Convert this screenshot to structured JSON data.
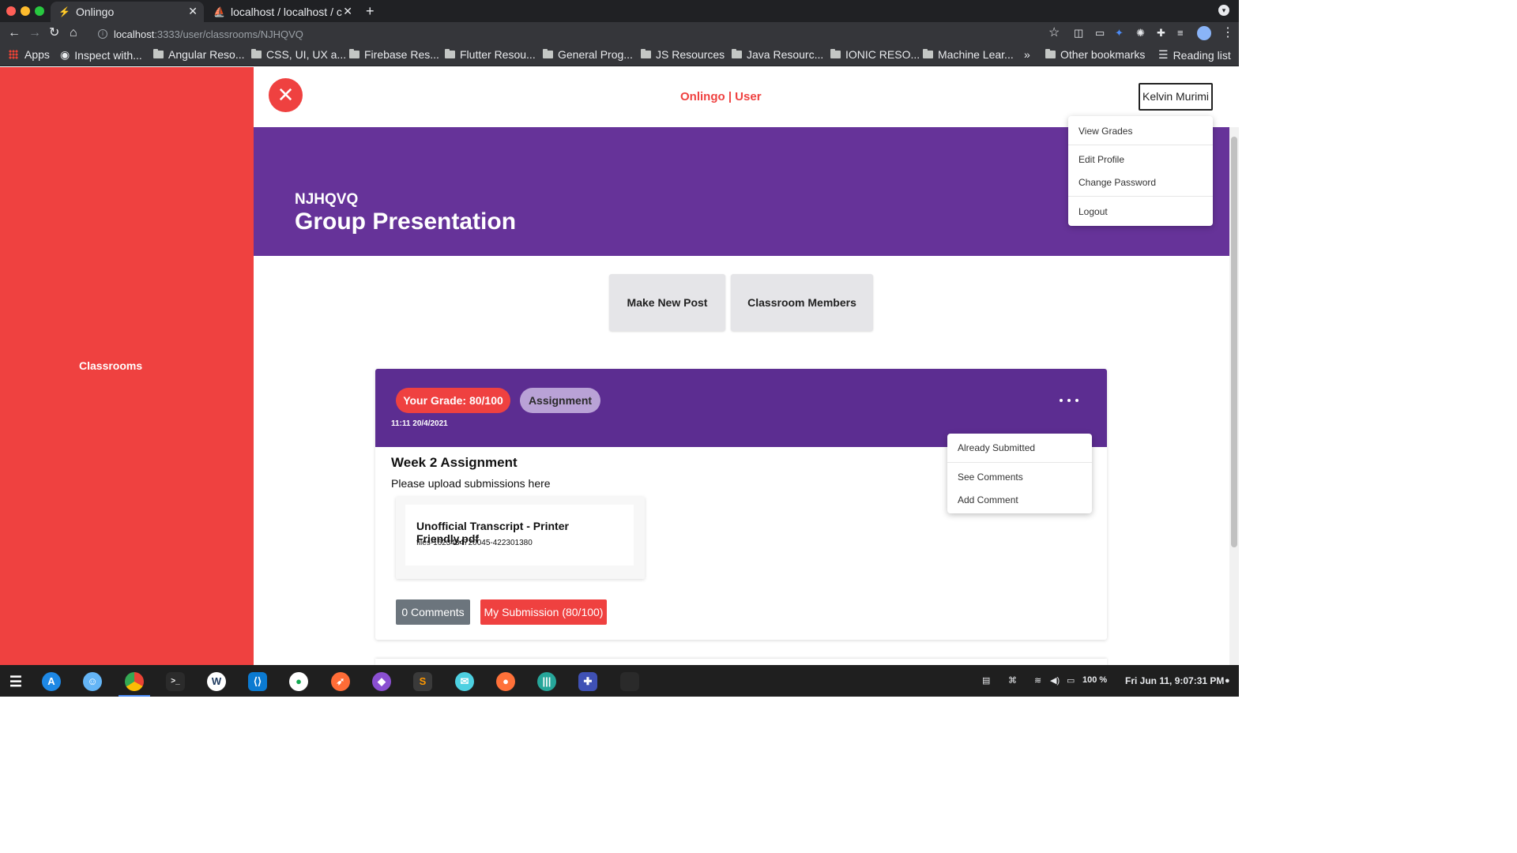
{
  "browser": {
    "tabs": [
      {
        "title": "Onlingo",
        "active": true
      },
      {
        "title": "localhost / localhost / c",
        "active": false
      }
    ],
    "new_tab": "+",
    "url_host": "localhost",
    "url_path": ":3333/user/classrooms/NJHQVQ",
    "bookmarks": [
      "Apps",
      "Inspect with...",
      "Angular Reso...",
      "CSS, UI, UX a...",
      "Firebase Res...",
      "Flutter Resou...",
      "General Prog...",
      "JS Resources",
      "Java Resourc...",
      "IONIC RESO...",
      "Machine Lear...",
      "»",
      "Other bookmarks",
      "Reading list"
    ]
  },
  "app": {
    "title": "Onlingo | User",
    "close_glyph": "✕",
    "user_name": "Kelvin Murimi",
    "user_menu": [
      "View Grades",
      "Edit Profile",
      "Change Password",
      "Logout"
    ],
    "sidebar": {
      "items": [
        "Classrooms"
      ]
    }
  },
  "classroom": {
    "code": "NJHQVQ",
    "name": "Group Presentation",
    "actions": [
      "Make New Post",
      "Classroom Members"
    ]
  },
  "post": {
    "grade": "Your Grade: 80/100",
    "type": "Assignment",
    "timestamp": "11:11 20/4/2021",
    "title": "Week 2 Assignment",
    "description": "Please upload submissions here",
    "file_name": "Unofficial Transcript - Printer Friendly.pdf",
    "file_id": "files-1623434720045-422301380",
    "comments_button": "0 Comments",
    "submission_button": "My Submission (80/100)",
    "menu": [
      "Already Submitted",
      "See Comments",
      "Add Comment"
    ]
  },
  "system": {
    "battery": "100 %",
    "clock": "Fri Jun 11,  9:07:31 PM"
  },
  "colors": {
    "accent_red": "#ef4140",
    "banner_purple": "#663399",
    "card_purple": "#5c2d91"
  }
}
